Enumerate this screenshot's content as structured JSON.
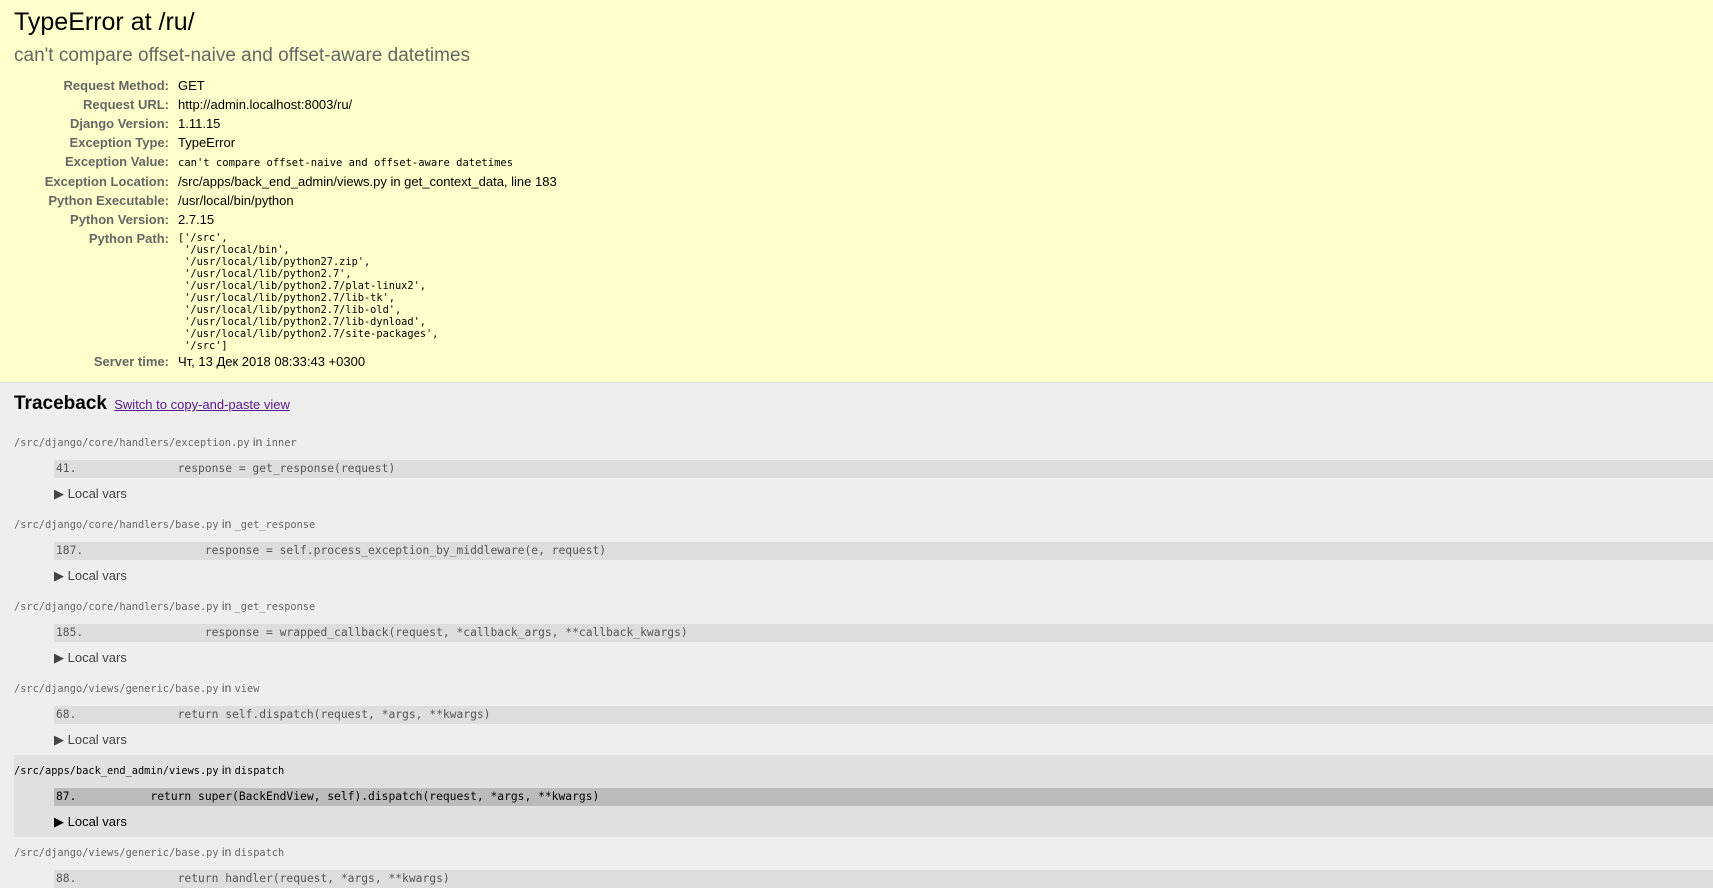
{
  "summary": {
    "title": "TypeError at /ru/",
    "exception_value": "can't compare offset-naive and offset-aware datetimes",
    "meta": [
      {
        "label": "Request Method:",
        "value": "GET"
      },
      {
        "label": "Request URL:",
        "value": "http://admin.localhost:8003/ru/"
      },
      {
        "label": "Django Version:",
        "value": "1.11.15"
      },
      {
        "label": "Exception Type:",
        "value": "TypeError"
      },
      {
        "label": "Exception Value:",
        "value": "can't compare offset-naive and offset-aware datetimes"
      },
      {
        "label": "Exception Location:",
        "value": "/src/apps/back_end_admin/views.py in get_context_data, line 183"
      },
      {
        "label": "Python Executable:",
        "value": "/usr/local/bin/python"
      },
      {
        "label": "Python Version:",
        "value": "2.7.15"
      },
      {
        "label": "Python Path:",
        "value": "['/src',\n '/usr/local/bin',\n '/usr/local/lib/python27.zip',\n '/usr/local/lib/python2.7',\n '/usr/local/lib/python2.7/plat-linux2',\n '/usr/local/lib/python2.7/lib-tk',\n '/usr/local/lib/python2.7/lib-old',\n '/usr/local/lib/python2.7/lib-dynload',\n '/usr/local/lib/python2.7/site-packages',\n '/src']"
      },
      {
        "label": "Server time:",
        "value": "Чт, 13 Дек 2018 08:33:43 +0300"
      }
    ]
  },
  "traceback": {
    "title": "Traceback",
    "switch_link": "Switch to copy-and-paste view",
    "in_word": "in",
    "local_vars": "▶ Local vars",
    "frames": [
      {
        "file": "/src/django/core/handlers/exception.py",
        "func": "inner",
        "lineno": "41.",
        "code": "            response = get_response(request)"
      },
      {
        "file": "/src/django/core/handlers/base.py",
        "func": "_get_response",
        "lineno": "187.",
        "code": "                response = self.process_exception_by_middleware(e, request)"
      },
      {
        "file": "/src/django/core/handlers/base.py",
        "func": "_get_response",
        "lineno": "185.",
        "code": "                response = wrapped_callback(request, *callback_args, **callback_kwargs)"
      },
      {
        "file": "/src/django/views/generic/base.py",
        "func": "view",
        "lineno": "68.",
        "code": "            return self.dispatch(request, *args, **kwargs)"
      },
      {
        "file": "/src/apps/back_end_admin/views.py",
        "func": "dispatch",
        "lineno": "87.",
        "code": "        return super(BackEndView, self).dispatch(request, *args, **kwargs)"
      },
      {
        "file": "/src/django/views/generic/base.py",
        "func": "dispatch",
        "lineno": "88.",
        "code": "            return handler(request, *args, **kwargs)"
      }
    ]
  }
}
